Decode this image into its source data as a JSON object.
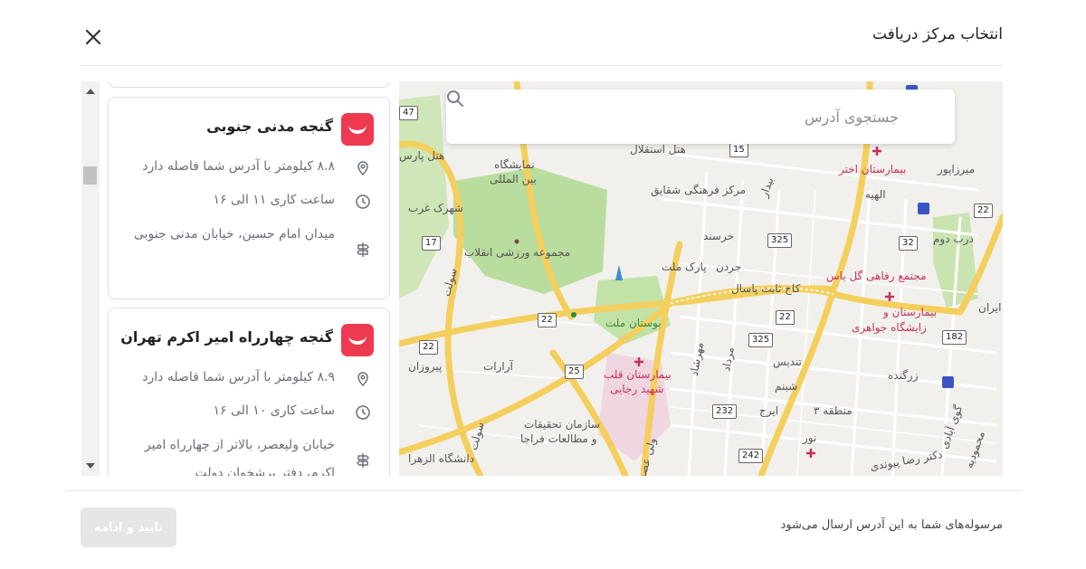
{
  "header": {
    "title": "انتخاب مرکز دریافت",
    "close_icon": "close-icon"
  },
  "search": {
    "placeholder": "جستجوی آدرس",
    "icon": "search-icon"
  },
  "centers": [
    {
      "name": "گنجه مدنی جنوبی",
      "distance": "۸.۸ کیلومتر با آدرس شما فاصله دارد",
      "hours": "ساعت کاری ۱۱ الی ۱۶",
      "address": "میدان امام حسین، خیابان مدنی جنوبی"
    },
    {
      "name": "گنجه چهارراه امیر اکرم تهران",
      "distance": "۸.۹ کیلومتر با آدرس شما فاصله دارد",
      "hours": "ساعت کاری ۱۰ الی ۱۶",
      "address": "خیابان ولیعصر، بالاتر از چهارراه امیر اکرم، دفتر پرشخوان دولت"
    }
  ],
  "map": {
    "labels": {
      "hotel_esteghlal": "هتل استقلال",
      "hotel_pars": "هتل پارس",
      "namayeshgah": "نمایشگاه",
      "beynolmelali": "بین المللی",
      "markaz_shaghayegh": "مرکز فرهنگی شقایق",
      "bimarestan_akhtar": "بیمارستان اختر",
      "mirzapour": "میرزاپور",
      "elahieh": "الهیه",
      "darbe_dovom": "درب دوم",
      "shahrak_gharb": "شهرک غرب",
      "enghelab_complex": "مجموعه ورزشی انقلاب",
      "khersand": "خرسند",
      "jordan": "جردن",
      "park_mellat": "پارک ملت",
      "kakh_paseal": "کاخ ثابت پاسال",
      "golyas": "مجتمع رفاهی گل یاس",
      "jahavery1": "بیمارستان و",
      "jahavery2": "زایشگاه جواهری",
      "iran": "ایران",
      "bustan_mellat": "بوستان ملت",
      "sowlat": "سولت",
      "pirouzan": "پیروزان",
      "ararat": "آرارات",
      "ghalb1": "بیمارستان قلب",
      "ghalb2": "شهید رجایی",
      "mehrshad": "مهرشاد",
      "mordad": "مرداد",
      "tandis": "تندیس",
      "shabnam": "شبنم",
      "iraj": "ایرج",
      "mantagheh": "منطقه ۳",
      "zargandeh": "زرگنده",
      "gavazi": "گوی آبادی",
      "tahghighat1": "سازمان تحقیقات",
      "tahghighat2": "و مطالعات فراجا",
      "sowlat2": "سولت",
      "alzahra": "دانشگاه الزهرا",
      "vali": "ولی عصر",
      "nour": "نور",
      "peyvandi": "دکتر رضا پیوندی",
      "mahmoudieh": "محمودیه",
      "pasdaran": "بیدار"
    },
    "shields": [
      "47",
      "15",
      "17",
      "325",
      "32",
      "22",
      "22",
      "22",
      "22",
      "325",
      "182",
      "25",
      "232",
      "242",
      "22"
    ]
  },
  "footer": {
    "note": "مرسوله‌های شما به این آدرس ارسال می‌شود",
    "confirm_label": "تایید و ادامه"
  },
  "colors": {
    "brand": "#ed3a50",
    "button_disabled": "#e6e6e8"
  }
}
